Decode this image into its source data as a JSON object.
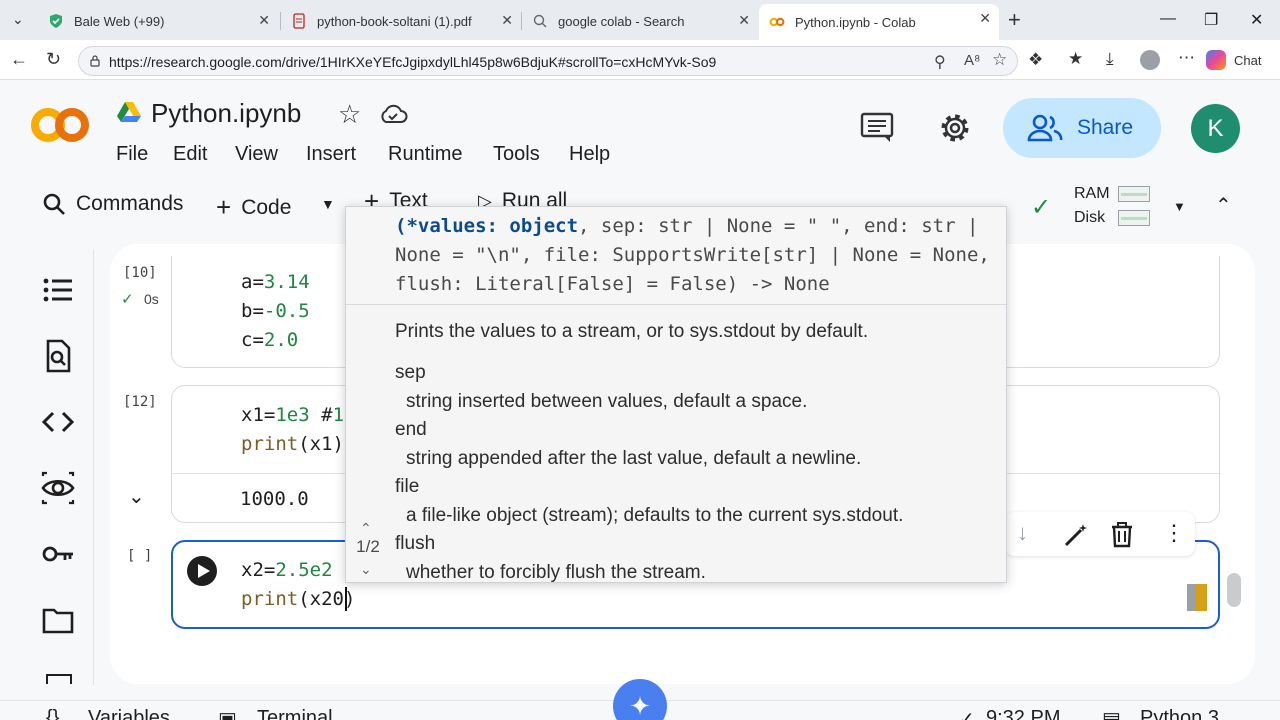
{
  "browser": {
    "tabs": [
      {
        "label": "Bale Web (+99)",
        "icon": "bale-shield-icon",
        "active": false
      },
      {
        "label": "python-book-soltani (1).pdf",
        "icon": "pdf-icon",
        "active": false
      },
      {
        "label": "google colab - Search",
        "icon": "search-icon",
        "active": false
      },
      {
        "label": "Python.ipynb - Colab",
        "icon": "colab-icon",
        "active": true
      }
    ],
    "url": "https://research.google.com/drive/1HIrKXeYEfcJgipxdylLhl45p8w6BdjuK#scrollTo=cxHcMYvk-So9",
    "chat_label": "Chat"
  },
  "colab": {
    "title": "Python.ipynb",
    "menu": [
      "File",
      "Edit",
      "View",
      "Insert",
      "Runtime",
      "Tools",
      "Help"
    ],
    "share_label": "Share",
    "avatar_letter": "K",
    "toolbar": {
      "commands": "Commands",
      "code": "Code",
      "text": "Text",
      "run_all": "Run all"
    },
    "resources": {
      "ram": "RAM",
      "disk": "Disk"
    }
  },
  "cells": [
    {
      "exec": "[10]",
      "status": "0s",
      "lines": [
        "a=3.14",
        "b=-0.5",
        "c=2.0"
      ]
    },
    {
      "exec": "[12]",
      "lines": [
        "x1=1e3 #1",
        "print(x1)"
      ],
      "output": "1000.0"
    },
    {
      "exec": "[ ]",
      "lines": [
        "x2=2.5e2",
        "print(x20)"
      ]
    }
  ],
  "signature_popup": {
    "signature_lines": [
      "(*values: object, sep: str | None = \" \", end: str |",
      "None = \"\\n\", file: SupportsWrite[str] | None = None,",
      "flush: Literal[False] = False) -> None"
    ],
    "description": "Prints the values to a stream, or to sys.stdout by default.",
    "params": [
      {
        "name": "sep",
        "desc": "string inserted between values, default a space."
      },
      {
        "name": "end",
        "desc": "string appended after the last value, default a newline."
      },
      {
        "name": "file",
        "desc": "a file-like object (stream); defaults to the current sys.stdout."
      },
      {
        "name": "flush",
        "desc": "whether to forcibly flush the stream."
      }
    ],
    "pager": "1/2"
  },
  "bottom": {
    "variables": "Variables",
    "terminal": "Terminal",
    "time": "9:32 PM",
    "runtime": "Python 3"
  },
  "colors": {
    "accent": "#0b57d0",
    "share_bg": "#c2e7ff",
    "avatar_bg": "#1e8e6e",
    "number_green": "#1e8741"
  }
}
